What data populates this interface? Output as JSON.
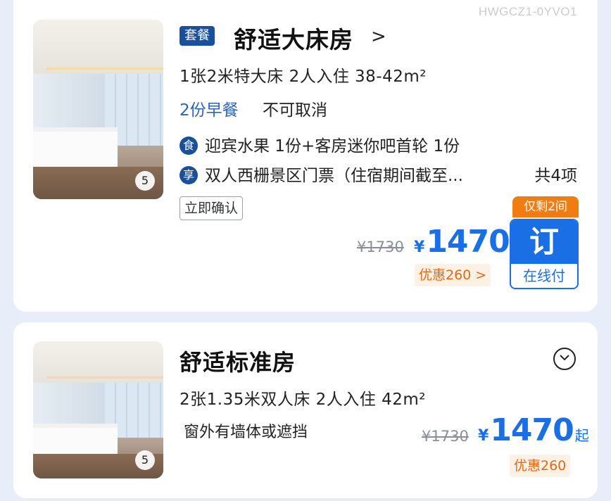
{
  "code": "HWGCZ1-0YVO1",
  "rooms": [
    {
      "package_badge": "套餐",
      "title": "舒适大床房",
      "title_chevron": ">",
      "spec": "1张2米特大床  2人入住  38-42m²",
      "photo_count": "5",
      "meal": "2份早餐",
      "cancel_policy": "不可取消",
      "perks": [
        {
          "icon": "食",
          "text": "迎宾水果 1份+客房迷你吧首轮 1份"
        },
        {
          "icon": "享",
          "text": "双人西栅景区门票（住宿期间截至..."
        }
      ],
      "perks_total": "共4项",
      "confirm_tag": "立即确认",
      "original_price": "¥1730",
      "currency": "¥",
      "price": "1470",
      "discount": "优惠260 >",
      "remaining": "仅剩2间",
      "book_label": "订",
      "pay_label": "在线付"
    },
    {
      "title": "舒适标准房",
      "spec": "2张1.35米双人床  2人入住  42m²",
      "photo_count": "5",
      "window_note": "窗外有墙体或遮挡",
      "original_price": "¥1730",
      "currency": "¥",
      "price": "1470",
      "price_suffix": "起",
      "discount": "优惠260"
    }
  ],
  "colors": {
    "accent_blue": "#1b6fe5",
    "badge_navy": "#1a4f9c",
    "orange": "#f07d12",
    "background": "#e8eef9"
  },
  "icons": [
    "photo-count-badge",
    "chevron-right-icon",
    "expand-chevron-down-icon",
    "meal-icon",
    "perk-icon"
  ]
}
